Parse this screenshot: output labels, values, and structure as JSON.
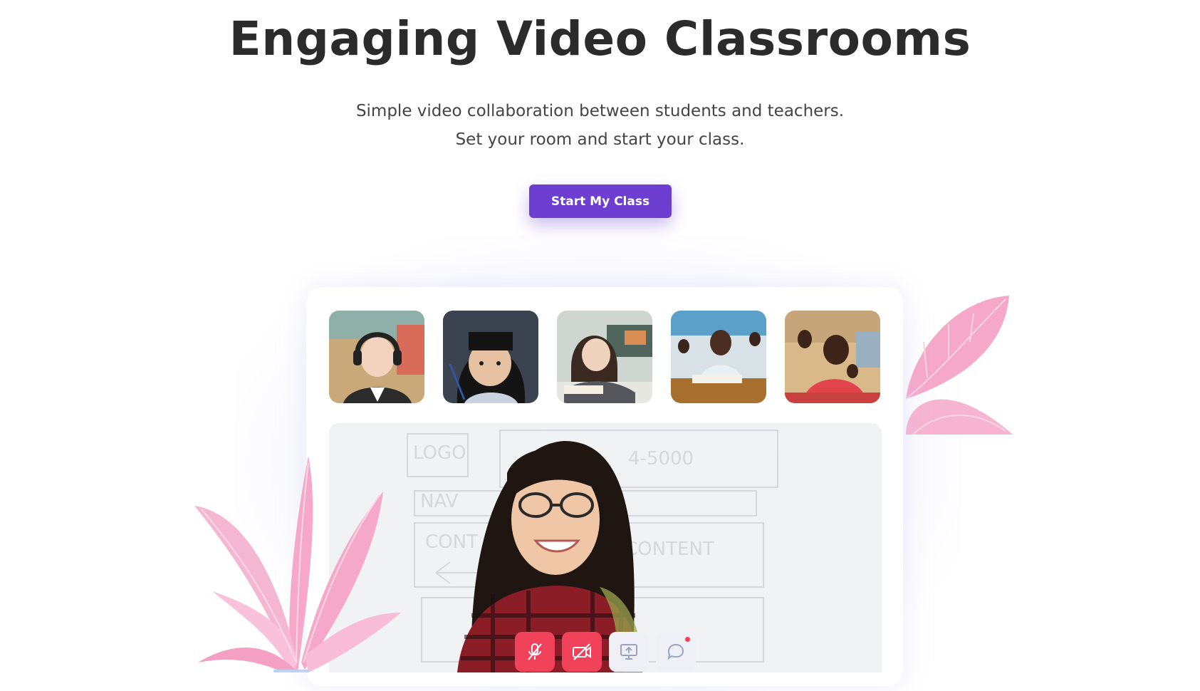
{
  "hero": {
    "title": "Engaging Video Classrooms",
    "subtitle_line1": "Simple video collaboration between students and teachers.",
    "subtitle_line2": "Set your room and start your class.",
    "cta_label": "Start My Class"
  },
  "colors": {
    "accent": "#6c3fd0",
    "danger": "#f0425a",
    "plant": "#f5a3c7"
  },
  "classroom": {
    "participants": [
      {
        "name": "participant-1",
        "icon": "student-with-headphones"
      },
      {
        "name": "participant-2",
        "icon": "student-girl"
      },
      {
        "name": "participant-3",
        "icon": "student-reading"
      },
      {
        "name": "participant-4",
        "icon": "student-writing"
      },
      {
        "name": "participant-5",
        "icon": "student-waving"
      }
    ],
    "main_video": {
      "icon": "teacher-video"
    },
    "controls": [
      {
        "name": "mute-mic-button",
        "icon": "mic-off-icon",
        "state": "off"
      },
      {
        "name": "camera-off-button",
        "icon": "camera-off-icon",
        "state": "off"
      },
      {
        "name": "share-screen-button",
        "icon": "screen-share-icon",
        "state": "idle"
      },
      {
        "name": "chat-button",
        "icon": "chat-icon",
        "state": "unread"
      }
    ]
  }
}
